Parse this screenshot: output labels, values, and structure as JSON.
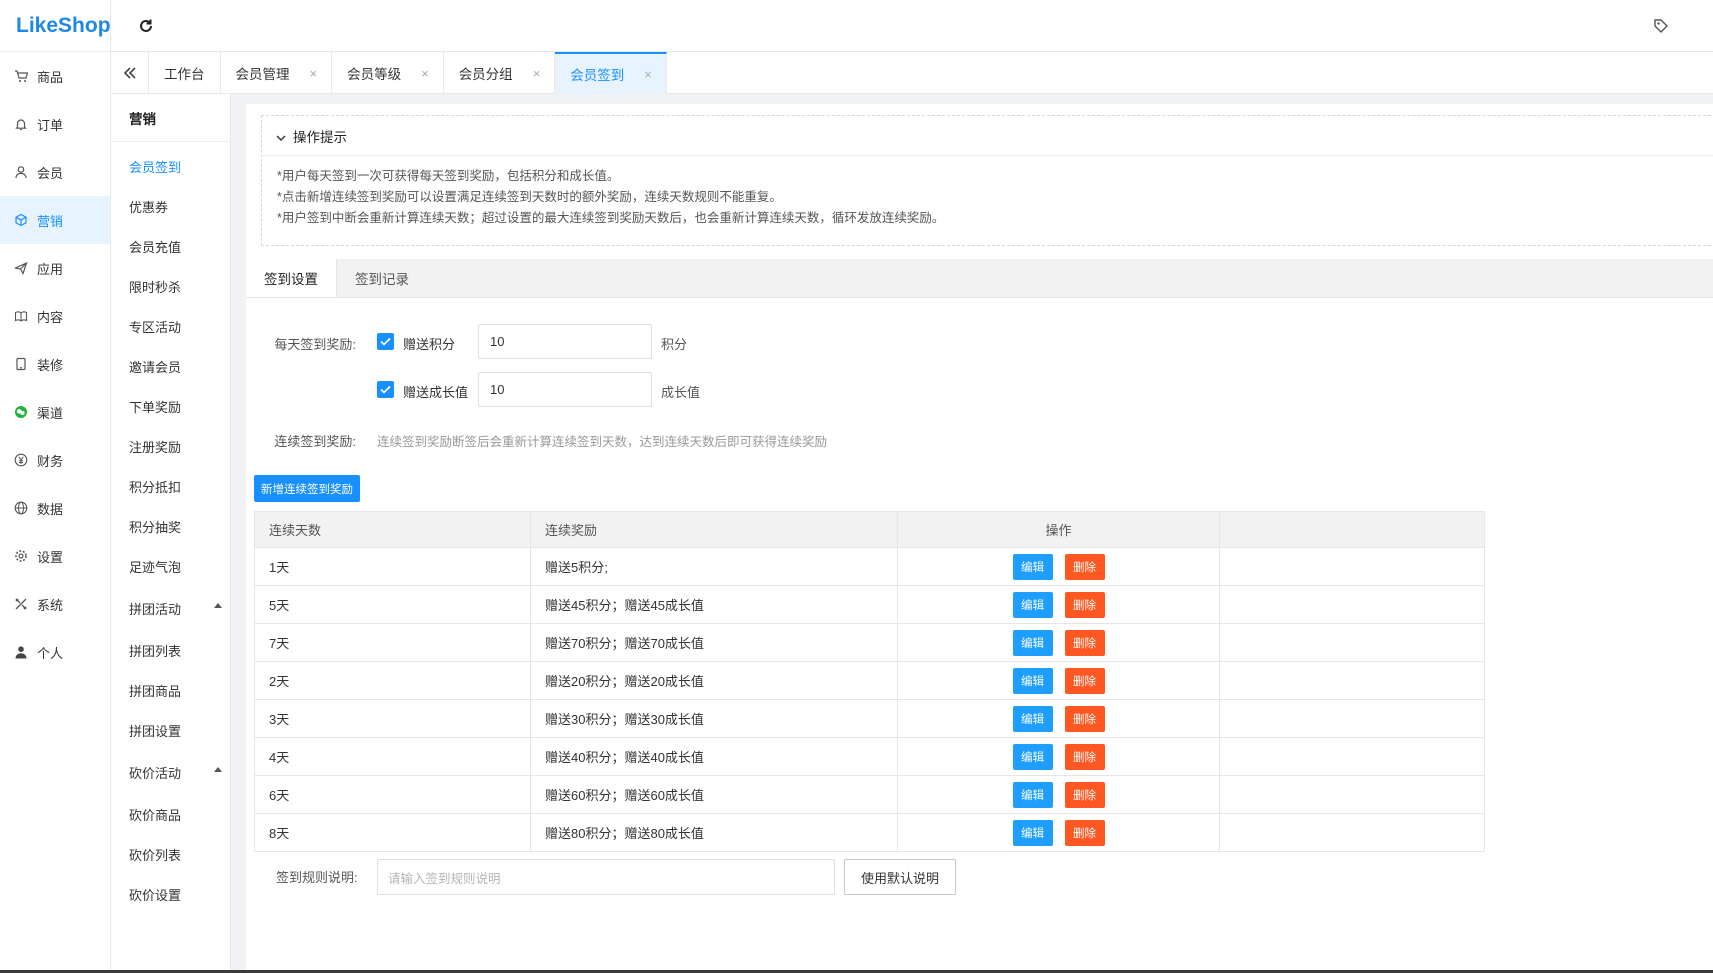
{
  "app": {
    "logo_prefix": "Like",
    "logo_suffix": "Shop"
  },
  "main_nav": [
    {
      "label": "商品",
      "icon": "cart-icon"
    },
    {
      "label": "订单",
      "icon": "bell-icon"
    },
    {
      "label": "会员",
      "icon": "user-icon"
    },
    {
      "label": "营销",
      "icon": "cube-icon",
      "active": true
    },
    {
      "label": "应用",
      "icon": "send-icon"
    },
    {
      "label": "内容",
      "icon": "book-icon"
    },
    {
      "label": "装修",
      "icon": "tablet-icon"
    },
    {
      "label": "渠道",
      "icon": "wechat-icon"
    },
    {
      "label": "财务",
      "icon": "yen-icon"
    },
    {
      "label": "数据",
      "icon": "globe-icon"
    },
    {
      "label": "设置",
      "icon": "gear-icon"
    },
    {
      "label": "系统",
      "icon": "tools-icon"
    },
    {
      "label": "个人",
      "icon": "person-icon"
    }
  ],
  "tabs": [
    {
      "label": "工作台"
    },
    {
      "label": "会员管理"
    },
    {
      "label": "会员等级"
    },
    {
      "label": "会员分组"
    },
    {
      "label": "会员签到",
      "active": true
    }
  ],
  "sub_nav": {
    "title": "营销",
    "items": [
      {
        "label": "会员签到",
        "active": true
      },
      {
        "label": "优惠券"
      },
      {
        "label": "会员充值"
      },
      {
        "label": "限时秒杀"
      },
      {
        "label": "专区活动"
      },
      {
        "label": "邀请会员"
      },
      {
        "label": "下单奖励"
      },
      {
        "label": "注册奖励"
      },
      {
        "label": "积分抵扣"
      },
      {
        "label": "积分抽奖"
      },
      {
        "label": "足迹气泡"
      },
      {
        "label": "拼团活动",
        "group": true
      },
      {
        "label": "拼团列表"
      },
      {
        "label": "拼团商品"
      },
      {
        "label": "拼团设置"
      },
      {
        "label": "砍价活动",
        "group": true
      },
      {
        "label": "砍价商品"
      },
      {
        "label": "砍价列表"
      },
      {
        "label": "砍价设置"
      }
    ]
  },
  "tips": {
    "title": "操作提示",
    "lines": [
      "*用户每天签到一次可获得每天签到奖励，包括积分和成长值。",
      "*点击新增连续签到奖励可以设置满足连续签到天数时的额外奖励，连续天数规则不能重复。",
      "*用户签到中断会重新计算连续天数；超过设置的最大连续签到奖励天数后，也会重新计算连续天数，循环发放连续奖励。"
    ]
  },
  "inner_tabs": [
    {
      "label": "签到设置",
      "active": true
    },
    {
      "label": "签到记录"
    }
  ],
  "daily": {
    "label": "每天签到奖励:",
    "points_check": "赠送积分",
    "points_value": "10",
    "points_unit": "积分",
    "growth_check": "赠送成长值",
    "growth_value": "10",
    "growth_unit": "成长值"
  },
  "continuous": {
    "label": "连续签到奖励:",
    "hint": "连续签到奖励断签后会重新计算连续签到天数，达到连续天数后即可获得连续奖励",
    "add_button": "新增连续签到奖励"
  },
  "table": {
    "headers": [
      "连续天数",
      "连续奖励",
      "操作"
    ],
    "edit_label": "编辑",
    "delete_label": "删除",
    "rows": [
      {
        "days": "1天",
        "reward": "赠送5积分;"
      },
      {
        "days": "5天",
        "reward": "赠送45积分；赠送45成长值"
      },
      {
        "days": "7天",
        "reward": "赠送70积分；赠送70成长值"
      },
      {
        "days": "2天",
        "reward": "赠送20积分；赠送20成长值"
      },
      {
        "days": "3天",
        "reward": "赠送30积分；赠送30成长值"
      },
      {
        "days": "4天",
        "reward": "赠送40积分；赠送40成长值"
      },
      {
        "days": "6天",
        "reward": "赠送60积分；赠送60成长值"
      },
      {
        "days": "8天",
        "reward": "赠送80积分；赠送80成长值"
      }
    ]
  },
  "rule": {
    "label": "签到规则说明:",
    "placeholder": "请输入签到规则说明",
    "default_button": "使用默认说明"
  },
  "colors": {
    "primary": "#1890ff",
    "edit": "#1e9fff",
    "delete": "#ff5722"
  }
}
